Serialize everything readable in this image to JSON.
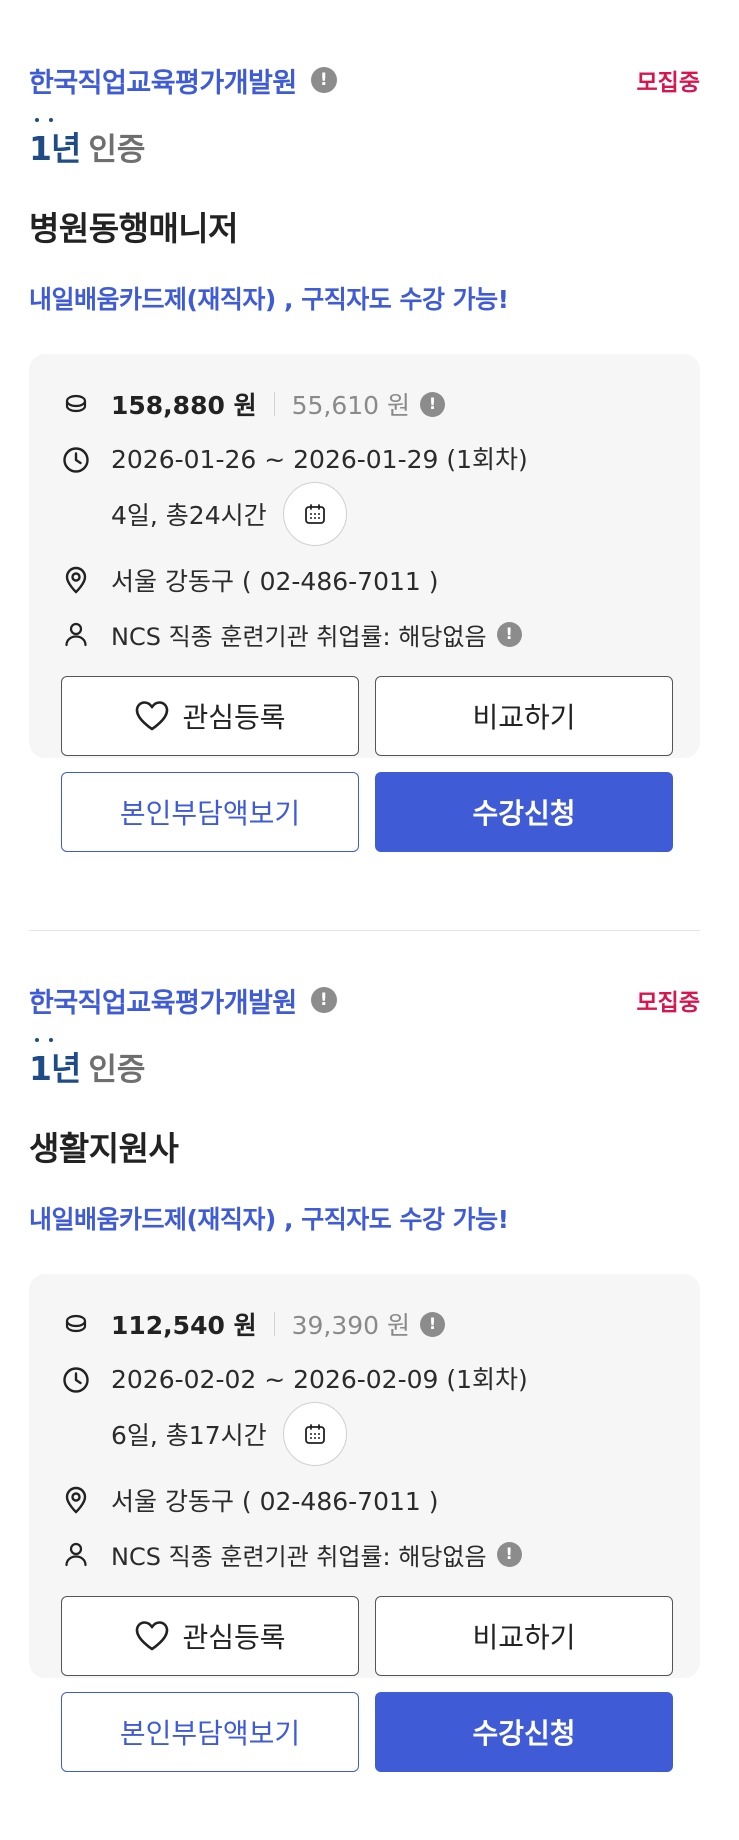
{
  "courses": [
    {
      "org_name": "한국직업교육평가개발원",
      "status": "모집중",
      "cert_logo": "1년",
      "cert_label": "인증",
      "title": "병원동행매니저",
      "subtitle": "내일배움카드제(재직자) , 구직자도 수강 가능!",
      "price": "158,880 원",
      "self_price": "55,610 원",
      "date_range": "2026-01-26 ~ 2026-01-29 (1회차)",
      "duration": "4일, 총24시간",
      "location": "서울 강동구 ( 02-486-7011 )",
      "ncs": "NCS 직종 훈련기관 취업률: 해당없음",
      "btn_wish": "관심등록",
      "btn_compare": "비교하기",
      "btn_self_pay": "본인부담액보기",
      "btn_apply": "수강신청"
    },
    {
      "org_name": "한국직업교육평가개발원",
      "status": "모집중",
      "cert_logo": "1년",
      "cert_label": "인증",
      "title": "생활지원사",
      "subtitle": "내일배움카드제(재직자) , 구직자도 수강 가능!",
      "price": "112,540 원",
      "self_price": "39,390 원",
      "date_range": "2026-02-02 ~ 2026-02-09 (1회차)",
      "duration": "6일, 총17시간",
      "location": "서울 강동구 ( 02-486-7011 )",
      "ncs": "NCS 직종 훈련기관 취업률: 해당없음",
      "btn_wish": "관심등록",
      "btn_compare": "비교하기",
      "btn_self_pay": "본인부담액보기",
      "btn_apply": "수강신청"
    }
  ],
  "info_glyph": "!",
  "colors": {
    "accent": "#3f5bd6",
    "status": "#d8154f",
    "cert": "#1f4c87"
  }
}
